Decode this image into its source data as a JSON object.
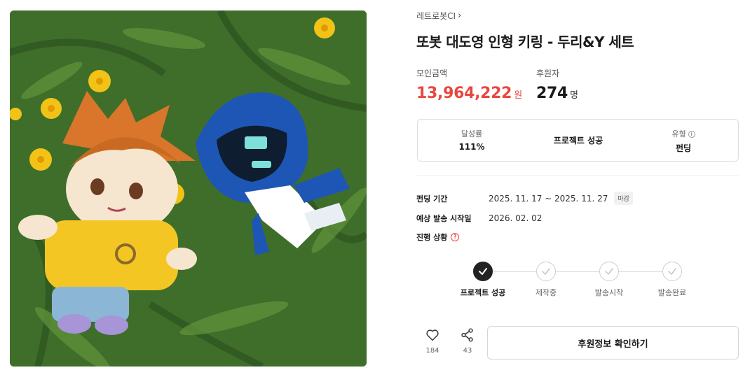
{
  "project": {
    "creator": "레트로봇CI",
    "title": "또봇 대도영 인형 키링 - 두리&Y 세트"
  },
  "stats": {
    "amount_label": "모인금액",
    "amount_value": "13,964,222",
    "amount_unit": "원",
    "backers_label": "후원자",
    "backers_value": "274",
    "backers_unit": "명"
  },
  "summary": {
    "achievement_label": "달성률",
    "achievement_value": "111%",
    "status_value": "프로젝트 성공",
    "type_label": "유형",
    "type_value": "펀딩"
  },
  "details": {
    "period_label": "펀딩 기간",
    "period_value": "2025. 11. 17 ~ 2025. 11. 27",
    "period_badge": "마감",
    "ship_label": "예상 발송 시작일",
    "ship_value": "2026. 02. 02",
    "progress_label": "진행 상황"
  },
  "steps": [
    {
      "label": "프로젝트 성공",
      "done": true
    },
    {
      "label": "제작중",
      "done": false
    },
    {
      "label": "발송시작",
      "done": false
    },
    {
      "label": "발송완료",
      "done": false
    }
  ],
  "actions": {
    "like_count": "184",
    "share_count": "43",
    "cta_label": "후원정보 확인하기"
  },
  "icons": [
    "chevron-right-icon",
    "info-icon",
    "help-icon",
    "check-icon",
    "heart-icon",
    "share-icon"
  ],
  "colors": {
    "accent": "#e8483f",
    "step_done": "#222222"
  }
}
